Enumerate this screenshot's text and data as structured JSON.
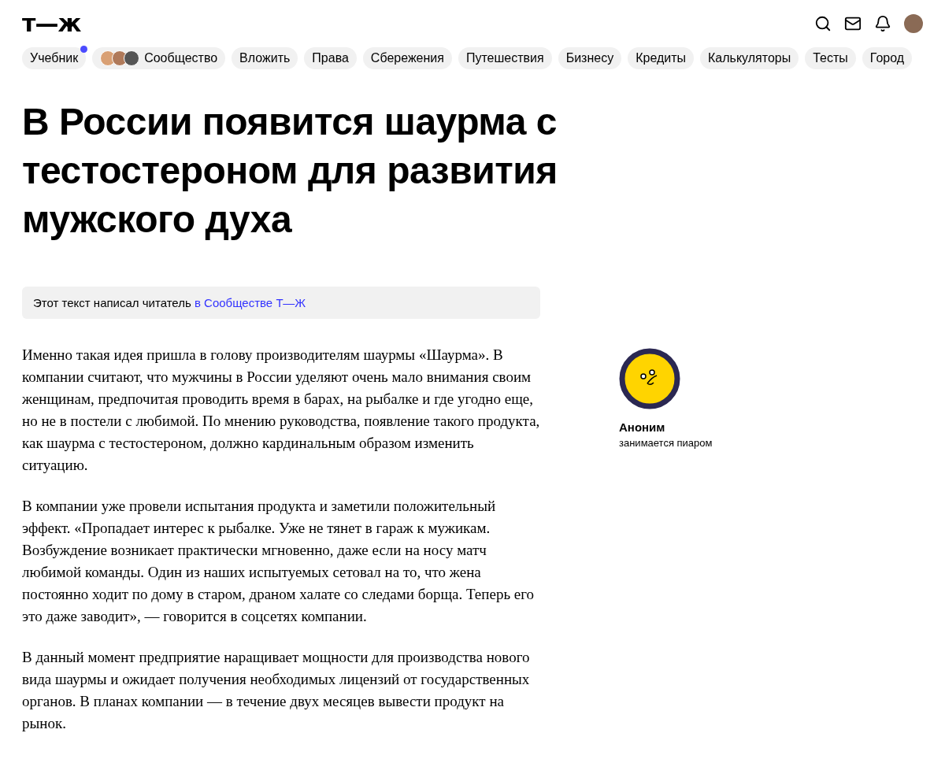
{
  "logo": "т—ж",
  "nav": [
    {
      "label": "Учебник",
      "kind": "plain",
      "dot": true
    },
    {
      "label": "Сообщество",
      "kind": "avatars",
      "dot": false
    },
    {
      "label": "Вложить",
      "kind": "plain",
      "dot": false
    },
    {
      "label": "Права",
      "kind": "plain",
      "dot": false
    },
    {
      "label": "Сбережения",
      "kind": "plain",
      "dot": false
    },
    {
      "label": "Путешествия",
      "kind": "plain",
      "dot": false
    },
    {
      "label": "Бизнесу",
      "kind": "plain",
      "dot": false
    },
    {
      "label": "Кредиты",
      "kind": "plain",
      "dot": false
    },
    {
      "label": "Калькуляторы",
      "kind": "plain",
      "dot": false
    },
    {
      "label": "Тесты",
      "kind": "plain",
      "dot": false
    },
    {
      "label": "Город",
      "kind": "plain",
      "dot": false
    }
  ],
  "title": "В России появится шаурма с тестостероном для развития мужского духа",
  "note": {
    "text": "Этот текст написал читатель",
    "link": "в Сообществе Т—Ж"
  },
  "paragraphs": [
    "Именно такая идея пришла в голову производителям шаурмы «Шаурма». В компании считают, что мужчины в России уделяют очень мало внимания своим женщинам, предпочитая проводить время в барах, на рыбалке и где угодно еще, но не в постели с любимой. По мнению руководства, появление такого продукта, как шаурма с тестостероном, должно кардинальным образом изменить ситуацию.",
    "В компании уже провели испытания продукта и заметили положительный эффект. «Пропадает интерес к рыбалке. Уже не тянет в гараж к мужикам. Возбуждение возникает практически мгновенно, даже если на носу матч любимой команды. Один из наших испытуемых сетовал на то, что жена постоянно ходит по дому в старом, драном халате со следами борща. Теперь его это даже заводит», — говорится в соцсетях компании.",
    "В данный момент предприятие наращивает мощности для производства нового вида шаурмы и ожидает получения необходимых лицензий от государственных органов. В планах компании — в течение двух месяцев вывести продукт на рынок."
  ],
  "author": {
    "name": "Аноним",
    "role": "занимается пиаром"
  }
}
